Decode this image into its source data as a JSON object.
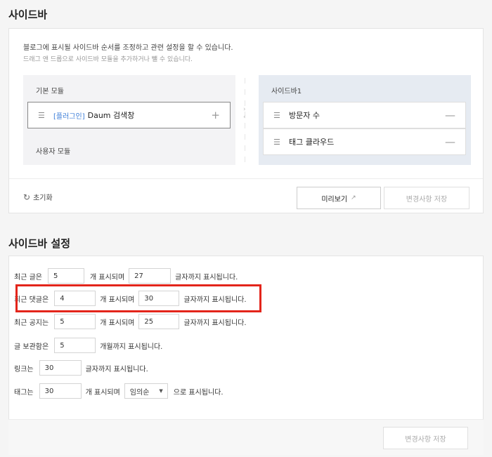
{
  "sidebar_section": {
    "title": "사이드바",
    "description": "블로그에 표시될 사이드바 순서를 조정하고 관련 설정을 할 수 있습니다.",
    "hint": "드래그 앤 드롭으로 사이드바 모듈을 추가하거나 뺄 수 있습니다.",
    "left_column": {
      "basic_header": "기본 모듈",
      "user_header": "사용자 모듈",
      "modules": [
        {
          "tag": "[플러그인]",
          "name": "Daum 검색창",
          "action": "+"
        }
      ]
    },
    "right_column": {
      "header": "사이드바1",
      "modules": [
        {
          "name": "방문자 수",
          "action": "—"
        },
        {
          "name": "태그 클라우드",
          "action": "—"
        }
      ]
    },
    "reset_label": "초기화",
    "preview_label": "미리보기",
    "save_label": "변경사항 저장"
  },
  "settings_section": {
    "title": "사이드바 설정",
    "recent_posts": {
      "label": "최근 글은",
      "count": "5",
      "mid": "개 표시되며",
      "chars": "27",
      "suffix": "글자까지 표시됩니다."
    },
    "recent_comments": {
      "label": "최근 댓글은",
      "count": "4",
      "mid": "개 표시되며",
      "chars": "30",
      "suffix": "글자까지 표시됩니다."
    },
    "recent_notices": {
      "label": "최근 공지는",
      "count": "5",
      "mid": "개 표시되며",
      "chars": "25",
      "suffix": "글자까지 표시됩니다."
    },
    "archive": {
      "label": "글 보관함은",
      "count": "5",
      "suffix": "개월까지 표시됩니다."
    },
    "links": {
      "label": "링크는",
      "chars": "30",
      "suffix": "글자까지 표시됩니다."
    },
    "tags": {
      "label": "태그는",
      "count": "30",
      "mid": "개 표시되며",
      "order": "임의순",
      "suffix": "으로 표시됩니다."
    },
    "save_label": "변경사항 저장"
  },
  "icons": {
    "drag": "drag-handle-icon",
    "reset": "refresh-icon",
    "external": "external-link-icon",
    "caret": "caret-down-icon"
  },
  "colors": {
    "highlight": "#e3251b",
    "plugin_tag": "#3b7dd8",
    "active_column": "#e6ebf2"
  }
}
